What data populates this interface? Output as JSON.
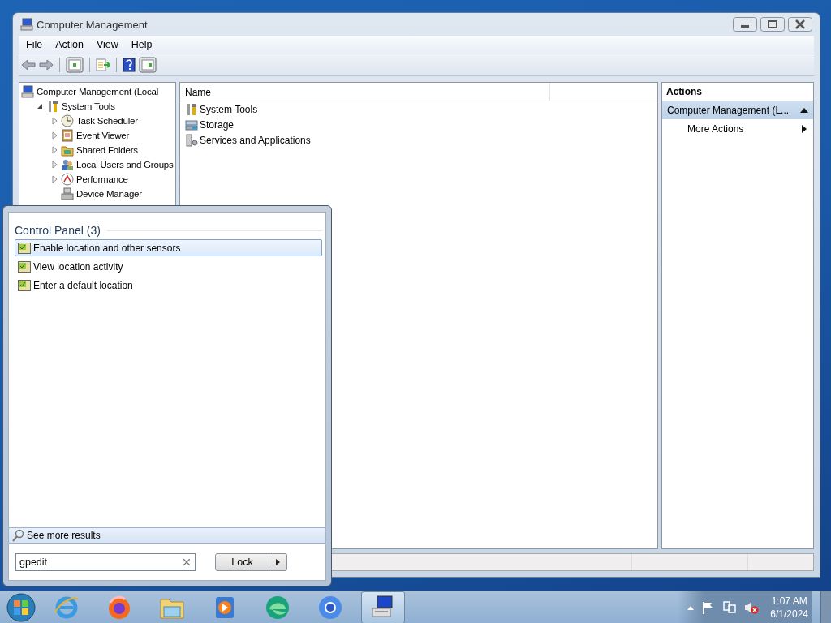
{
  "window": {
    "title": "Computer Management",
    "menu": [
      "File",
      "Action",
      "View",
      "Help"
    ],
    "tree": [
      {
        "label": "Computer Management (Local",
        "kind": "computer",
        "expandable": false,
        "children": [
          {
            "label": "System Tools",
            "kind": "tools",
            "expandable": true,
            "expanded": true,
            "children": [
              {
                "label": "Task Scheduler",
                "kind": "clock",
                "expandable": true,
                "expanded": false
              },
              {
                "label": "Event Viewer",
                "kind": "log",
                "expandable": true,
                "expanded": false
              },
              {
                "label": "Shared Folders",
                "kind": "folder",
                "expandable": true,
                "expanded": false
              },
              {
                "label": "Local Users and Groups",
                "kind": "users",
                "expandable": true,
                "expanded": false
              },
              {
                "label": "Performance",
                "kind": "gauge",
                "expandable": true,
                "expanded": false
              },
              {
                "label": "Device Manager",
                "kind": "device",
                "expandable": false
              }
            ]
          }
        ]
      }
    ],
    "list": {
      "columns": [
        "Name"
      ],
      "rows": [
        {
          "label": "System Tools",
          "kind": "tools"
        },
        {
          "label": "Storage",
          "kind": "storage"
        },
        {
          "label": "Services and Applications",
          "kind": "services"
        }
      ]
    },
    "actions": {
      "title": "Actions",
      "section": {
        "label": "Computer Management (L...",
        "expanded": true
      },
      "items": [
        {
          "label": "More Actions"
        }
      ]
    }
  },
  "start_menu": {
    "group": "Control Panel (3)",
    "results": [
      {
        "label": "Enable location and other sensors",
        "selected": true
      },
      {
        "label": "View location activity",
        "selected": false
      },
      {
        "label": "Enter a default location",
        "selected": false
      }
    ],
    "see_more": "See more results",
    "search": {
      "value": "gpedit"
    },
    "power_button": "Lock"
  },
  "taskbar": {
    "apps": [
      {
        "kind": "ie",
        "selected": false
      },
      {
        "kind": "firefox",
        "selected": false
      },
      {
        "kind": "explorer",
        "selected": false
      },
      {
        "kind": "media",
        "selected": false
      },
      {
        "kind": "edge",
        "selected": false
      },
      {
        "kind": "chrome",
        "selected": false
      },
      {
        "kind": "computer",
        "selected": true
      }
    ],
    "time": "1:07 AM",
    "date": "6/1/2024"
  }
}
